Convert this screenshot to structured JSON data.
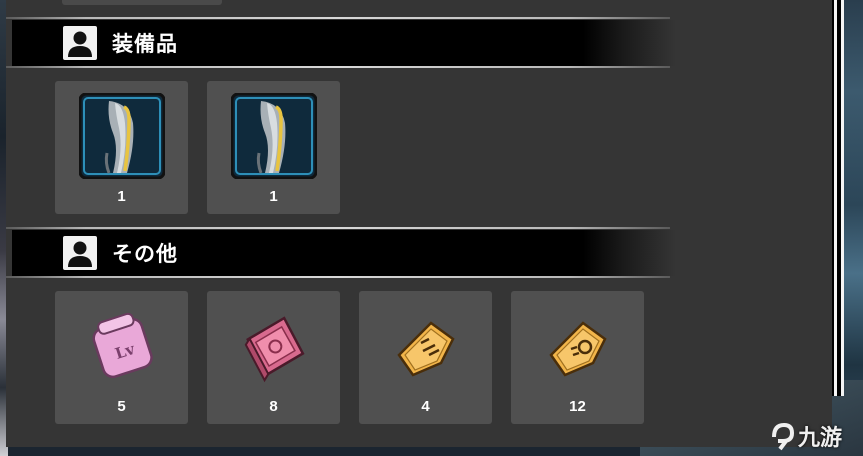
{
  "sections": [
    {
      "title": "装備品",
      "icon": "person-icon",
      "items": [
        {
          "icon": "leg-armor-icon",
          "count": "1"
        },
        {
          "icon": "leg-armor-icon",
          "count": "1"
        }
      ]
    },
    {
      "title": "その他",
      "icon": "person-icon",
      "items": [
        {
          "icon": "pink-ticket-icon",
          "count": "5"
        },
        {
          "icon": "red-ticket-icon",
          "count": "8"
        },
        {
          "icon": "gold-ticket-icon",
          "count": "4"
        },
        {
          "icon": "gold-ticket-icon",
          "count": "12"
        }
      ]
    }
  ],
  "watermark": {
    "text": "九游"
  },
  "colors": {
    "panel": "#353535",
    "card": "#505050",
    "header_band": "#000000",
    "divider": "#d0d0d0",
    "count_text": "#ffffff"
  }
}
